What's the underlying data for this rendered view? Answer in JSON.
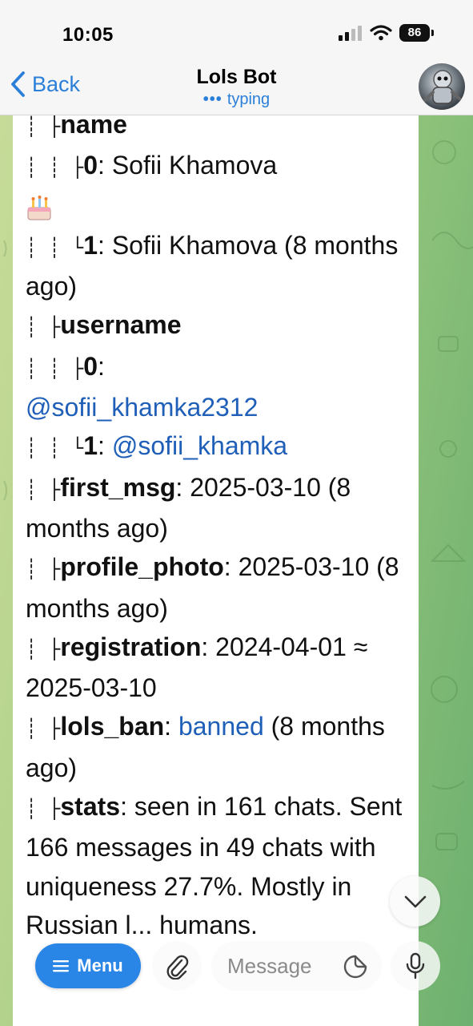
{
  "status_bar": {
    "time": "10:05",
    "battery": "86"
  },
  "header": {
    "back_label": "Back",
    "title": "Lols Bot",
    "status_dots": "•••",
    "status_text": "typing"
  },
  "message": {
    "lines": [
      {
        "tree": "┊   ├",
        "key": "name",
        "rest": ""
      },
      {
        "tree": "┊   ┊    ├",
        "key": "0",
        "rest": ": Sofii Khamova"
      },
      {
        "emoji": "cake-emoji"
      },
      {
        "tree": "┊   ┊    └",
        "key": "1",
        "rest": ": Sofii Khamova (8 months ago)"
      },
      {
        "tree": "┊   ├",
        "key": "username",
        "rest": ""
      },
      {
        "tree": "┊   ┊    ├",
        "key": "0",
        "rest": ":",
        "link": "@sofii_khamka2312"
      },
      {
        "tree": "┊   ┊    └",
        "key": "1",
        "rest": ": ",
        "link": "@sofii_khamka"
      },
      {
        "tree": "┊   ├",
        "key": "first_msg",
        "rest": ": 2025-03-10 (8 months ago)"
      },
      {
        "tree": "┊   ├",
        "key": "profile_photo",
        "rest": ": 2025-03-10 (8 months ago)"
      },
      {
        "tree": "┊   ├",
        "key": "registration",
        "rest": ": 2024-04-01 ≈ 2025-03-10"
      },
      {
        "tree": "┊   ├",
        "key": "lols_ban",
        "rest": ": ",
        "link": "banned",
        "tail": " (8 months ago)"
      },
      {
        "tree": "┊   ├",
        "key": "stats",
        "rest": ": seen in 161 chats. Sent 166 messages in 49 chats with uniqueness 27.7%.  Mostly in Russian l",
        "tail": "...",
        "tail2": " humans."
      }
    ]
  },
  "controls": {
    "menu_label": "Menu",
    "message_placeholder": "Message"
  },
  "colors": {
    "accent": "#2a86e6",
    "link": "#1f5fb8",
    "header_bg": "#f6f6f6"
  },
  "icons": {
    "back": "chevron-left-icon",
    "signal": "cellular-signal-icon",
    "wifi": "wifi-icon",
    "scroll_down": "chevron-down-icon",
    "menu": "hamburger-icon",
    "attach": "paperclip-icon",
    "sticker": "sticker-icon",
    "mic": "microphone-icon"
  }
}
